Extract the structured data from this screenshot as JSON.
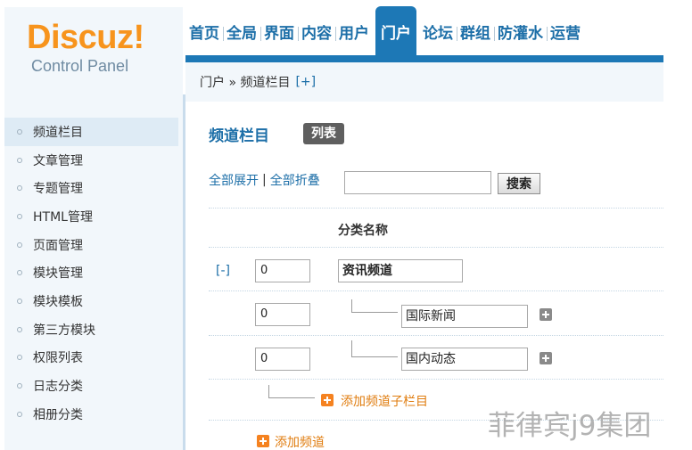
{
  "header": {
    "logo_text": "Discuz!",
    "logo_subtitle": "Control Panel",
    "nav": [
      {
        "label": "首页"
      },
      {
        "label": "全局"
      },
      {
        "label": "界面"
      },
      {
        "label": "内容"
      },
      {
        "label": "用户"
      },
      {
        "label": "门户",
        "active": true
      },
      {
        "label": "论坛"
      },
      {
        "label": "群组"
      },
      {
        "label": "防灌水"
      },
      {
        "label": "运营"
      }
    ]
  },
  "breadcrumb": {
    "text": "门户 » 频道栏目",
    "add_label": "[+]"
  },
  "sidebar": {
    "items": [
      {
        "label": "频道栏目",
        "active": true
      },
      {
        "label": "文章管理"
      },
      {
        "label": "专题管理"
      },
      {
        "label": "HTML管理"
      },
      {
        "label": "页面管理"
      },
      {
        "label": "模块管理"
      },
      {
        "label": "模块模板"
      },
      {
        "label": "第三方模块"
      },
      {
        "label": "权限列表"
      },
      {
        "label": "日志分类"
      },
      {
        "label": "相册分类"
      }
    ]
  },
  "main": {
    "title": "频道栏目",
    "list_badge": "列表",
    "expand_all": "全部展开",
    "separator": "|",
    "collapse_all": "全部折叠",
    "search_value": "",
    "search_button": "搜索",
    "column_header": "分类名称",
    "rows": [
      {
        "toggle": "[-]",
        "order": "0",
        "name": "资讯频道",
        "level": 0
      },
      {
        "order": "0",
        "name": "国际新闻",
        "level": 1
      },
      {
        "order": "0",
        "name": "国内动态",
        "level": 1
      }
    ],
    "add_sub_channel": "添加频道子栏目",
    "add_channel": "添加频道"
  },
  "watermark": "菲律宾j9集团",
  "colors": {
    "accent_blue": "#1d78b6",
    "link_blue": "#1d6fa8",
    "logo_orange": "#f7941d",
    "action_orange": "#f58220",
    "sidebar_bg": "#f2f7fb"
  }
}
